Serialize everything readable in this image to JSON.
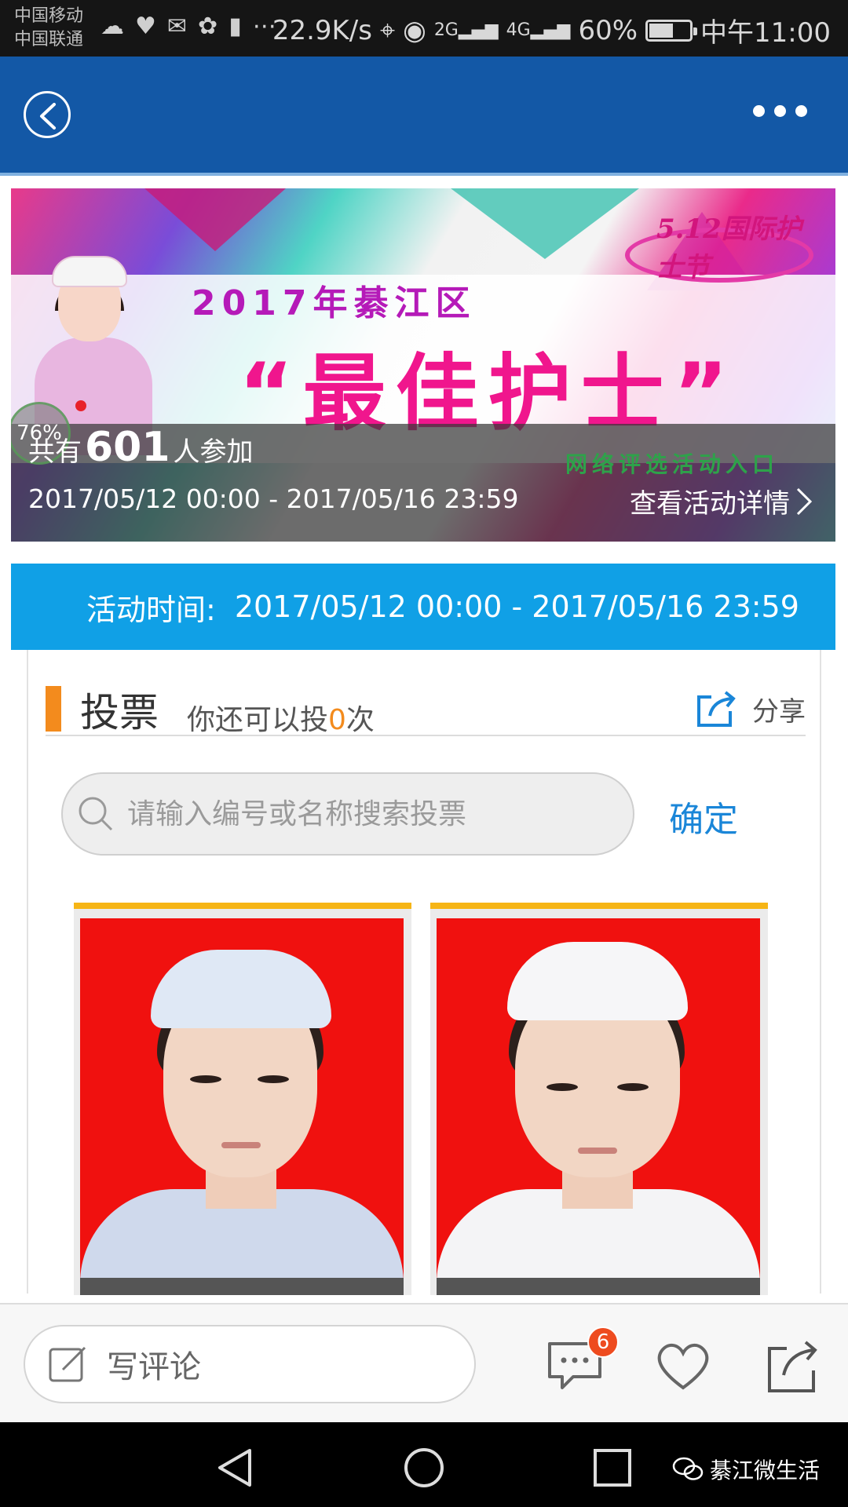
{
  "status_bar": {
    "carrier_1": "中国移动",
    "carrier_2": "中国联通",
    "net_speed": "22.9K/s",
    "net_2g": "2G",
    "net_4g": "4G",
    "battery_percent": "60%",
    "battery_level": 0.6,
    "time": "中午11:00",
    "icons": [
      "cloud-icon",
      "heart-rate-icon",
      "wechat-icon",
      "app-icon",
      "battery-saver-icon",
      "more-notifications-icon",
      "location-icon",
      "eye-icon",
      "signal-icon",
      "signal-icon",
      "battery-icon"
    ]
  },
  "app_bar": {
    "back_icon": "back-arrow-icon",
    "more_icon": "more-dots-icon"
  },
  "banner": {
    "year_line": "2017年綦江区",
    "title": "“最佳护士”",
    "logo_text": "5.12国际护士节",
    "entry_text": "网络评选活动入口",
    "participants_prefix": "共有",
    "participants_count": "601",
    "participants_suffix": "人参加",
    "date_range": "2017/05/12 00:00 - 2017/05/16 23:59",
    "details_link": "查看活动详情",
    "progress_badge": "76%"
  },
  "activity_time": {
    "label": "活动时间:",
    "value": "2017/05/12 00:00 - 2017/05/16 23:59"
  },
  "vote": {
    "title": "投票",
    "remaining_prefix": "你还可以投",
    "remaining_count": "0",
    "remaining_suffix": "次",
    "share_label": "分享",
    "search_placeholder": "请输入编号或名称搜索投票",
    "confirm_label": "确定"
  },
  "contestants": [
    {
      "uniform_color": "#cfd9ec",
      "cap_color": "#dfe8f5"
    },
    {
      "uniform_color": "#f4f4f6",
      "cap_color": "#f6f6f8"
    }
  ],
  "comment_bar": {
    "placeholder": "写评论",
    "comment_count": "6"
  },
  "nav_bar": {
    "watermark": "綦江微生活"
  },
  "colors": {
    "app_bar": "#1358a6",
    "time_bar": "#10a0e6",
    "accent_orange": "#f38b1d",
    "confirm_blue": "#1a86d8",
    "badge_red": "#ee4b1f"
  }
}
